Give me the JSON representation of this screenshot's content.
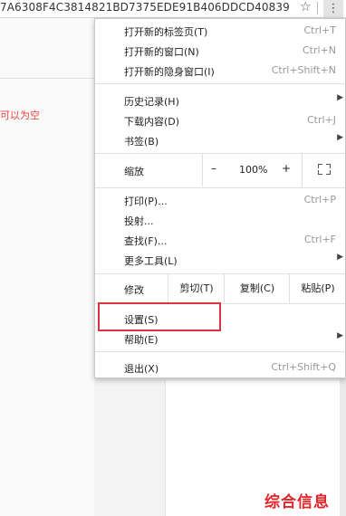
{
  "browser": {
    "url": "7A6308F4C3814821BD7375EDE91B406DDCD40839"
  },
  "page": {
    "red_text": "可以为空"
  },
  "menu": {
    "items_top": [
      {
        "label": "打开新的标签页(T)",
        "shortcut": "Ctrl+T"
      },
      {
        "label": "打开新的窗口(N)",
        "shortcut": "Ctrl+N"
      },
      {
        "label": "打开新的隐身窗口(I)",
        "shortcut": "Ctrl+Shift+N"
      }
    ],
    "items_history": [
      {
        "label": "历史记录(H)",
        "shortcut": ""
      },
      {
        "label": "下载内容(D)",
        "shortcut": "Ctrl+J"
      },
      {
        "label": "书签(B)",
        "shortcut": ""
      }
    ],
    "zoom": {
      "label": "缩放",
      "minus": "–",
      "value": "100%",
      "plus": "+"
    },
    "items_tools": [
      {
        "label": "打印(P)...",
        "shortcut": "Ctrl+P"
      },
      {
        "label": "投射...",
        "shortcut": ""
      },
      {
        "label": "查找(F)...",
        "shortcut": "Ctrl+F"
      },
      {
        "label": "更多工具(L)",
        "shortcut": ""
      }
    ],
    "edit": {
      "label": "修改",
      "cut": "剪切(T)",
      "copy": "复制(C)",
      "paste": "粘贴(P)"
    },
    "items_settings": [
      {
        "label": "设置(S)",
        "shortcut": ""
      },
      {
        "label": "帮助(E)",
        "shortcut": ""
      }
    ],
    "exit": {
      "label": "退出(X)",
      "shortcut": "Ctrl+Shift+Q"
    }
  },
  "watermark": "综合信息",
  "colors": {
    "highlight": "#d9363e",
    "watermark": "#e0262b",
    "red_text": "#e8453c"
  }
}
